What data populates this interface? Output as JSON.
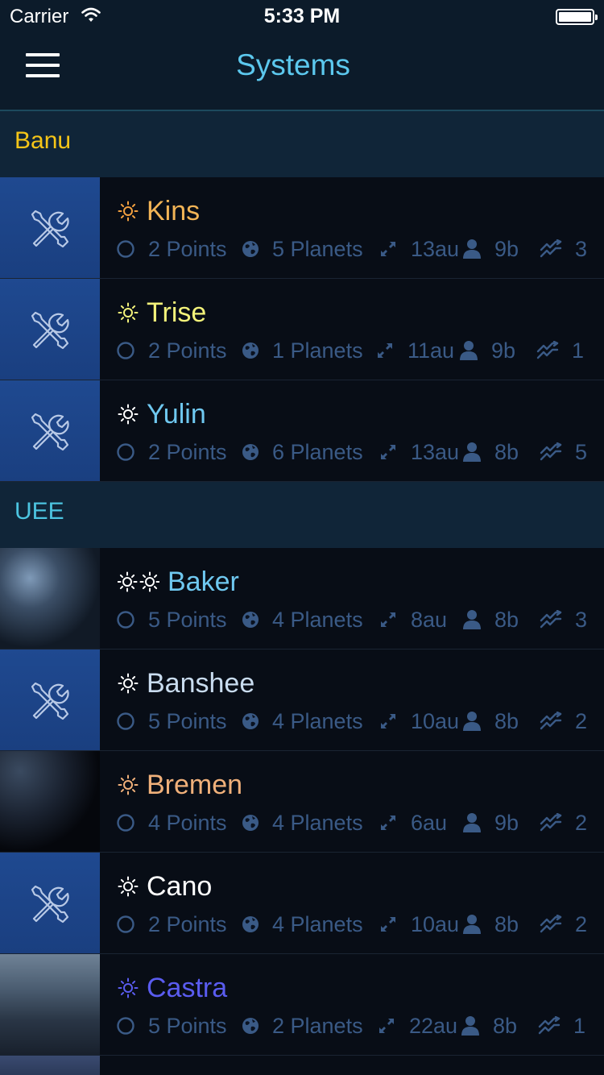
{
  "status_bar": {
    "carrier": "Carrier",
    "time": "5:33 PM"
  },
  "nav": {
    "title": "Systems"
  },
  "colors": {
    "banu_accent": "#f5c518",
    "uee_accent": "#4cc4e0",
    "stat_text": "#3a5a86",
    "placeholder_thumb": "#1f4990"
  },
  "sections": [
    {
      "label": "Banu",
      "color": "#f5c518",
      "systems": [
        {
          "name": "Kins",
          "name_color": "#f2b456",
          "star_icon": "sun-icon",
          "thumb": "tools-placeholder",
          "points": "2 Points",
          "planets": "5 Planets",
          "distance": "13au",
          "population": "9b",
          "jumps": "3"
        },
        {
          "name": "Trise",
          "name_color": "#f3f27a",
          "star_icon": "sun-icon",
          "thumb": "tools-placeholder",
          "points": "2 Points",
          "planets": "1 Planets",
          "distance": "11au",
          "population": "9b",
          "jumps": "1"
        },
        {
          "name": "Yulin",
          "name_color": "#6fc8f0",
          "star_icon": "sun-icon",
          "thumb": "tools-placeholder",
          "points": "2 Points",
          "planets": "6 Planets",
          "distance": "13au",
          "population": "8b",
          "jumps": "5"
        }
      ]
    },
    {
      "label": "UEE",
      "color": "#4cc4e0",
      "systems": [
        {
          "name": "Baker",
          "name_color": "#6fc8f0",
          "star_icon": "binary-sun-icon",
          "thumb": "space-station-image",
          "points": "5 Points",
          "planets": "4 Planets",
          "distance": "8au",
          "population": "8b",
          "jumps": "3"
        },
        {
          "name": "Banshee",
          "name_color": "#c9dcef",
          "star_icon": "sun-icon",
          "thumb": "tools-placeholder",
          "points": "5 Points",
          "planets": "4 Planets",
          "distance": "10au",
          "population": "8b",
          "jumps": "2"
        },
        {
          "name": "Bremen",
          "name_color": "#f0b07a",
          "star_icon": "sun-icon",
          "thumb": "planet-image",
          "points": "4 Points",
          "planets": "4 Planets",
          "distance": "6au",
          "population": "9b",
          "jumps": "2"
        },
        {
          "name": "Cano",
          "name_color": "#ffffff",
          "star_icon": "sun-icon",
          "thumb": "tools-placeholder",
          "points": "2 Points",
          "planets": "4 Planets",
          "distance": "10au",
          "population": "8b",
          "jumps": "2"
        },
        {
          "name": "Castra",
          "name_color": "#5a5cf0",
          "star_icon": "sun-icon",
          "thumb": "city-image",
          "points": "5 Points",
          "planets": "2 Planets",
          "distance": "22au",
          "population": "8b",
          "jumps": "1"
        }
      ]
    }
  ]
}
